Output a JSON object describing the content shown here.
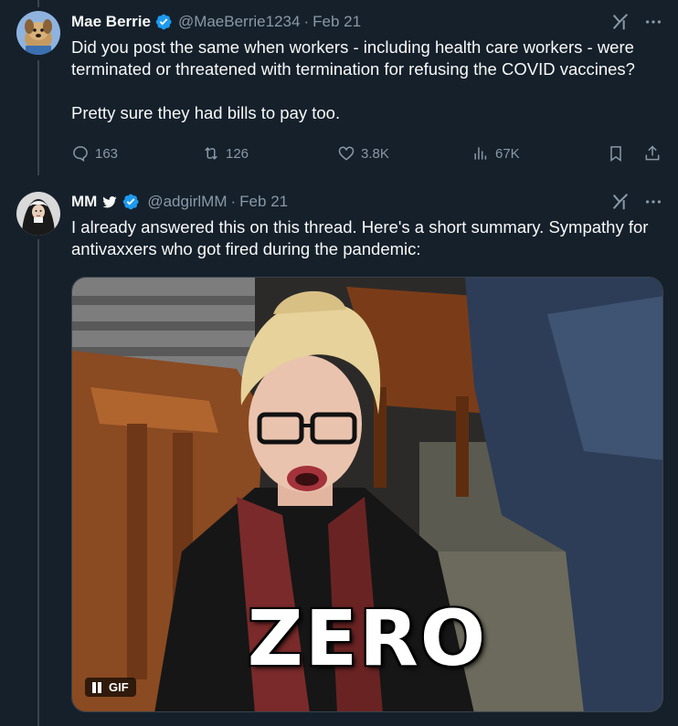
{
  "tweets": [
    {
      "display_name": "Mae Berrie",
      "handle": "@MaeBerrie1234",
      "date": "Feb 21",
      "separator": "·",
      "verified": true,
      "text_paragraphs": [
        "Did you post the same when workers - including health care workers - were terminated or threatened with termination for refusing the COVID vaccines?",
        "Pretty sure they had bills to pay too."
      ],
      "actions": {
        "replies": "163",
        "reposts": "126",
        "likes": "3.8K",
        "views": "67K"
      }
    },
    {
      "display_name": "MM",
      "handle": "@adgirlMM",
      "date": "Feb 21",
      "separator": "·",
      "verified": true,
      "name_emoji": "bird-icon",
      "text_paragraphs": [
        "I already answered this on this thread. Here's a short summary. Sympathy for antivaxxers who got fired during the pandemic:"
      ],
      "media": {
        "type": "gif",
        "caption": "ZERO",
        "badge": "GIF"
      }
    }
  ],
  "colors": {
    "background": "#15202b",
    "text": "#f7f9f9",
    "muted": "#8b98a5",
    "verified": "#1d9bf0",
    "divider": "#38444d"
  }
}
